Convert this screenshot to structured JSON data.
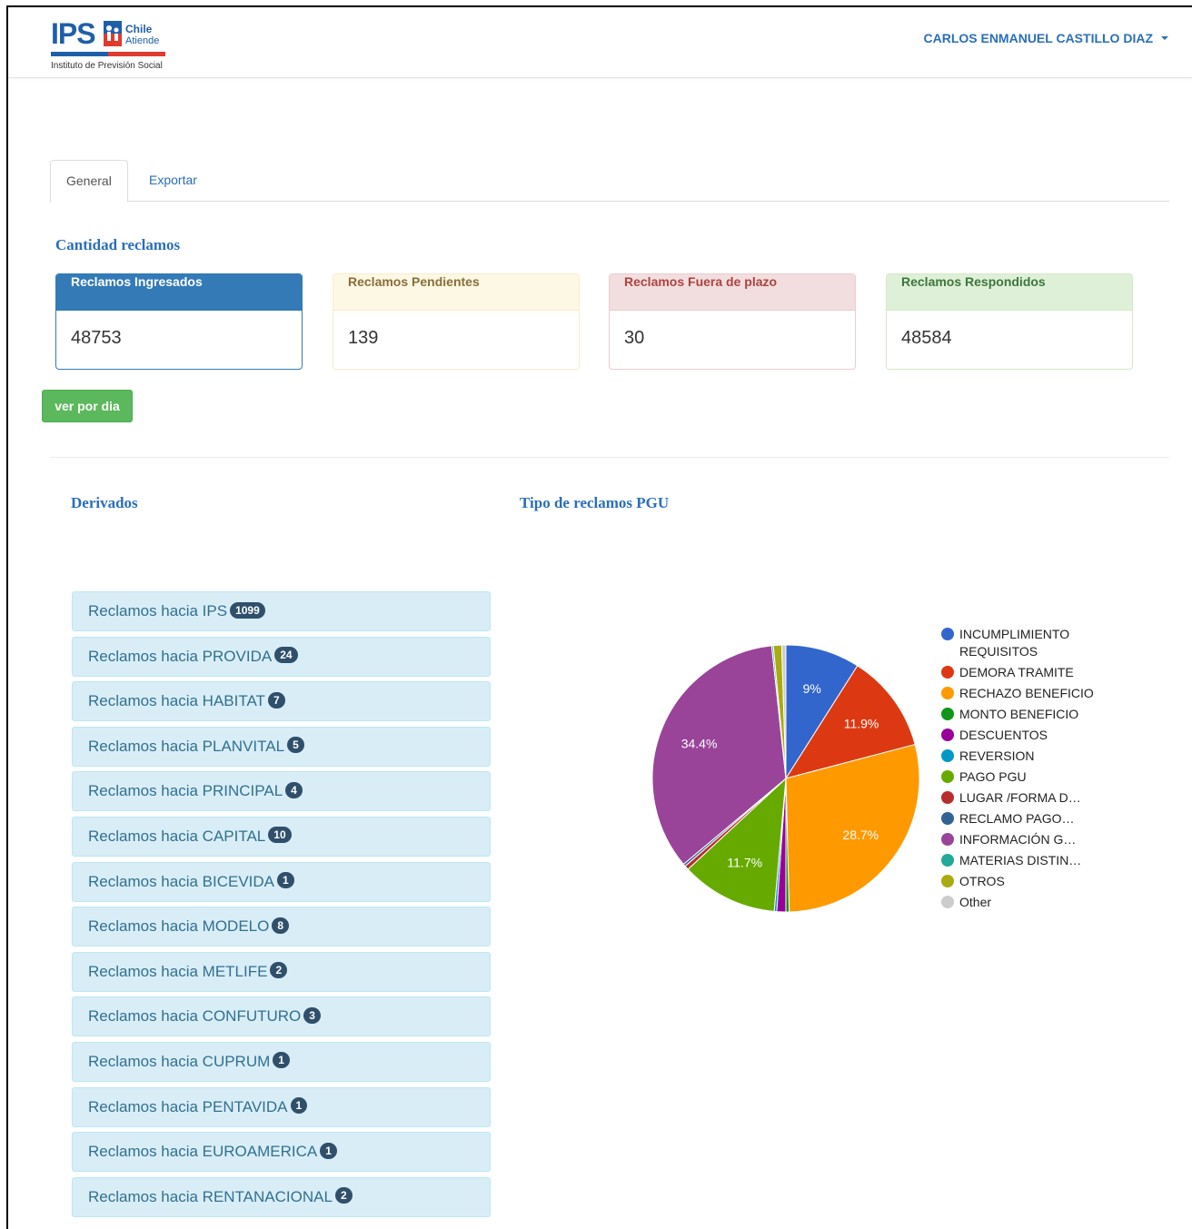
{
  "header": {
    "logo": {
      "brand": "IPS",
      "chile": "Chile",
      "atiende": "Atiende",
      "subtitle": "Instituto de Previsión Social"
    },
    "user_name": "CARLOS ENMANUEL CASTILLO DIAZ"
  },
  "tabs": [
    {
      "label": "General",
      "active": true
    },
    {
      "label": "Exportar",
      "active": false
    }
  ],
  "cantidad": {
    "title": "Cantidad reclamos",
    "cards": [
      {
        "label": "Reclamos Ingresados",
        "value": "48753"
      },
      {
        "label": "Reclamos Pendientes",
        "value": "139"
      },
      {
        "label": "Reclamos Fuera de plazo",
        "value": "30"
      },
      {
        "label": "Reclamos Respondidos",
        "value": "48584"
      }
    ],
    "button_label": "ver por dia"
  },
  "derivados": {
    "title": "Derivados",
    "items": [
      {
        "label": "Reclamos hacia IPS",
        "count": "1099"
      },
      {
        "label": "Reclamos hacia PROVIDA",
        "count": "24"
      },
      {
        "label": "Reclamos hacia HABITAT",
        "count": "7"
      },
      {
        "label": "Reclamos hacia PLANVITAL",
        "count": "5"
      },
      {
        "label": "Reclamos hacia PRINCIPAL",
        "count": "4"
      },
      {
        "label": "Reclamos hacia CAPITAL",
        "count": "10"
      },
      {
        "label": "Reclamos hacia BICEVIDA",
        "count": "1"
      },
      {
        "label": "Reclamos hacia MODELO",
        "count": "8"
      },
      {
        "label": "Reclamos hacia METLIFE",
        "count": "2"
      },
      {
        "label": "Reclamos hacia CONFUTURO",
        "count": "3"
      },
      {
        "label": "Reclamos hacia CUPRUM",
        "count": "1"
      },
      {
        "label": "Reclamos hacia PENTAVIDA",
        "count": "1"
      },
      {
        "label": "Reclamos hacia EUROAMERICA",
        "count": "1"
      },
      {
        "label": "Reclamos hacia RENTANACIONAL",
        "count": "2"
      }
    ]
  },
  "pgu": {
    "title": "Tipo de reclamos PGU"
  },
  "chart_data": {
    "type": "pie",
    "title": "Tipo de reclamos PGU",
    "legend_position": "right",
    "slices": [
      {
        "name": "INCUMPLIMIENTO REQUISITOS",
        "value": 9.0,
        "label": "9%",
        "color": "#3366cc"
      },
      {
        "name": "DEMORA TRAMITE",
        "value": 11.9,
        "label": "11.9%",
        "color": "#dc3912"
      },
      {
        "name": "RECHAZO BENEFICIO",
        "value": 28.7,
        "label": "28.7%",
        "color": "#ff9900"
      },
      {
        "name": "MONTO BENEFICIO",
        "value": 0.4,
        "label": "",
        "color": "#109618"
      },
      {
        "name": "DESCUENTOS",
        "value": 1.1,
        "label": "",
        "color": "#990099"
      },
      {
        "name": "REVERSION",
        "value": 0.3,
        "label": "",
        "color": "#0099c6"
      },
      {
        "name": "PAGO PGU",
        "value": 11.7,
        "label": "11.7%",
        "color": "#66aa00"
      },
      {
        "name": "LUGAR /FORMA D…",
        "value": 0.5,
        "label": "",
        "color": "#b82e2e"
      },
      {
        "name": "RECLAMO PAGO…",
        "value": 0.3,
        "label": "",
        "color": "#316395"
      },
      {
        "name": "INFORMACIÓN G…",
        "value": 34.4,
        "label": "34.4%",
        "color": "#994499"
      },
      {
        "name": "MATERIAS DISTIN…",
        "value": 0.2,
        "label": "",
        "color": "#22aa99"
      },
      {
        "name": "OTROS",
        "value": 1.0,
        "label": "",
        "color": "#aaaa11"
      },
      {
        "name": "Other",
        "value": 0.5,
        "label": "",
        "color": "#cccccc"
      }
    ]
  },
  "chart_legend": [
    {
      "label": "INCUMPLIMIENTO REQUISITOS",
      "color": "#3366cc"
    },
    {
      "label": "DEMORA TRAMITE",
      "color": "#dc3912"
    },
    {
      "label": "RECHAZO BENEFICIO",
      "color": "#ff9900"
    },
    {
      "label": "MONTO BENEFICIO",
      "color": "#109618"
    },
    {
      "label": "DESCUENTOS",
      "color": "#990099"
    },
    {
      "label": "REVERSION",
      "color": "#0099c6"
    },
    {
      "label": "PAGO PGU",
      "color": "#66aa00"
    },
    {
      "label": "LUGAR /FORMA D…",
      "color": "#b82e2e"
    },
    {
      "label": "RECLAMO PAGO…",
      "color": "#316395"
    },
    {
      "label": "INFORMACIÓN G…",
      "color": "#994499"
    },
    {
      "label": "MATERIAS DISTIN…",
      "color": "#22aa99"
    },
    {
      "label": "OTROS",
      "color": "#aaaa11"
    },
    {
      "label": "Other",
      "color": "#cccccc"
    }
  ]
}
